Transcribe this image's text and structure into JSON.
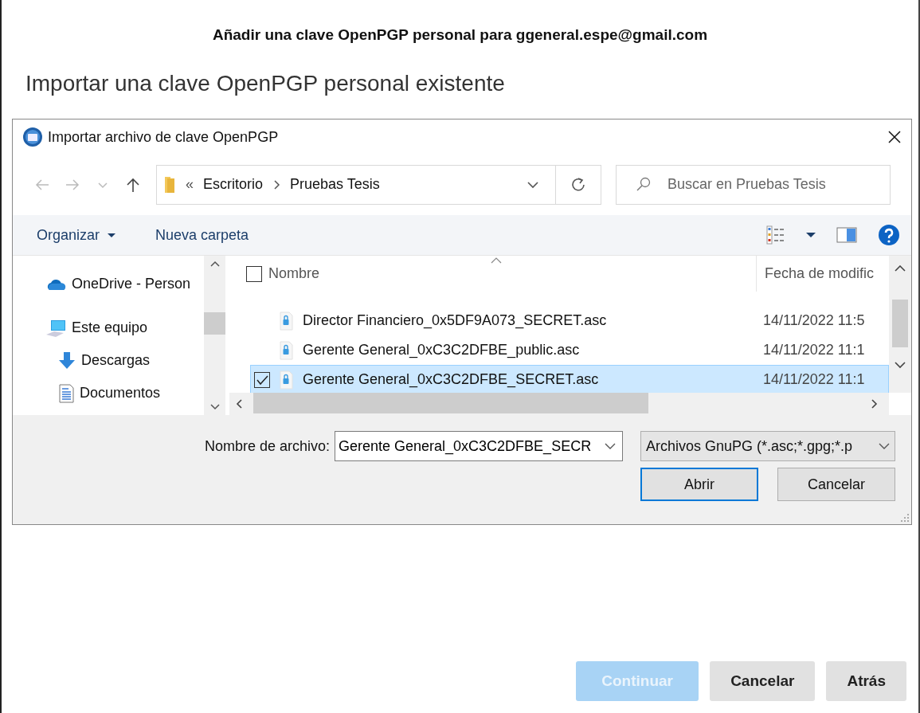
{
  "window": {
    "title": "Añadir una clave OpenPGP personal para ggeneral.espe@gmail.com",
    "heading": "Importar una clave OpenPGP personal existente"
  },
  "dialog": {
    "title": "Importar archivo de clave OpenPGP",
    "breadcrumb": {
      "overflow": "«",
      "items": [
        "Escritorio",
        "Pruebas Tesis"
      ]
    },
    "search": {
      "placeholder": "Buscar en Pruebas Tesis"
    },
    "toolbar": [
      {
        "label": "Organizar",
        "kind": "menu"
      },
      {
        "label": "Nueva carpeta",
        "kind": "button"
      }
    ],
    "sidebar": {
      "items": [
        {
          "label": "OneDrive - Person",
          "kind": "cloud"
        },
        {
          "label": "Este equipo",
          "kind": "computer",
          "children": [
            {
              "label": "Descargas",
              "kind": "download"
            },
            {
              "label": "Documentos",
              "kind": "document"
            }
          ]
        }
      ]
    },
    "table": {
      "columns": [
        "Nombre",
        "Fecha de modific"
      ],
      "select_all": {
        "checked": false
      },
      "rows": [
        {
          "name": "Director Financiero_0x5DF9A073_SECRET.asc",
          "date": "14/11/2022 11:5",
          "selected": false
        },
        {
          "name": "Gerente General_0xC3C2DFBE_public.asc",
          "date": "14/11/2022 11:1",
          "selected": false
        },
        {
          "name": "Gerente General_0xC3C2DFBE_SECRET.asc",
          "date": "14/11/2022 11:1",
          "selected": true
        }
      ]
    },
    "filename": {
      "label": "Nombre de archivo:",
      "value": "Gerente General_0xC3C2DFBE_SECR"
    },
    "filter": {
      "value": "Archivos GnuPG (*.asc;*.gpg;*.p"
    },
    "buttons": [
      {
        "label": "Abrir",
        "default": true
      },
      {
        "label": "Cancelar",
        "default": false
      }
    ]
  },
  "buttons": [
    {
      "label": "Continuar",
      "disabled": true
    },
    {
      "label": "Cancelar",
      "disabled": false
    },
    {
      "label": "Atrás",
      "disabled": false
    }
  ]
}
